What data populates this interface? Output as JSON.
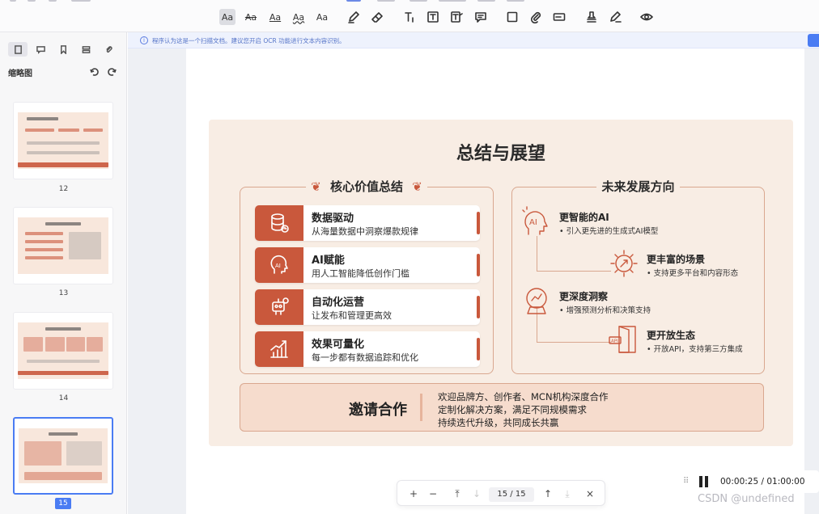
{
  "topbar": {
    "tools": [
      {
        "label": "Aa",
        "name": "text-style-highlight-tool"
      },
      {
        "label": "Aa",
        "name": "text-strikethrough-tool"
      },
      {
        "label": "Aa",
        "name": "text-underline-tool"
      },
      {
        "label": "Aa",
        "name": "text-squiggly-tool"
      },
      {
        "label": "Aa",
        "name": "text-caret-tool"
      }
    ]
  },
  "sidebar": {
    "title": "缩略图",
    "pages": [
      "12",
      "13",
      "14",
      "15"
    ]
  },
  "notice": {
    "text": "程序认为这是一个扫描文档。建议您开启 OCR 功能进行文本内容识别。"
  },
  "slide": {
    "title": "总结与展望",
    "left_title": "核心价值总结",
    "right_title": "未来发展方向",
    "values": [
      {
        "title": "数据驱动",
        "desc": "从海量数据中洞察爆款规律",
        "icon": "database-icon"
      },
      {
        "title": "AI赋能",
        "desc": "用人工智能降低创作门槛",
        "icon": "ai-head-icon"
      },
      {
        "title": "自动化运营",
        "desc": "让发布和管理更高效",
        "icon": "robot-icon"
      },
      {
        "title": "效果可量化",
        "desc": "每一步都有数据追踪和优化",
        "icon": "growth-chart-icon"
      }
    ],
    "future": [
      {
        "title": "更智能的AI",
        "desc": "• 引入更先进的生成式AI模型",
        "icon": "ai-brain-icon"
      },
      {
        "title": "更丰富的场景",
        "desc": "• 支持更多平台和内容形态",
        "icon": "network-icon"
      },
      {
        "title": "更深度洞察",
        "desc": "• 增强预测分析和决策支持",
        "icon": "crystal-ball-icon"
      },
      {
        "title": "更开放生态",
        "desc": "• 开放API，支持第三方集成",
        "icon": "open-door-icon"
      }
    ],
    "invite": {
      "title": "邀请合作",
      "lines": [
        "欢迎品牌方、创作者、MCN机构深度合作",
        "定制化解决方案，满足不同规模需求",
        "持续迭代升级，共同成长共赢"
      ]
    }
  },
  "pager": {
    "page": "15 / 15"
  },
  "player": {
    "time": "00:00:25 / 01:00:00"
  },
  "watermark": "CSDN @undefined"
}
